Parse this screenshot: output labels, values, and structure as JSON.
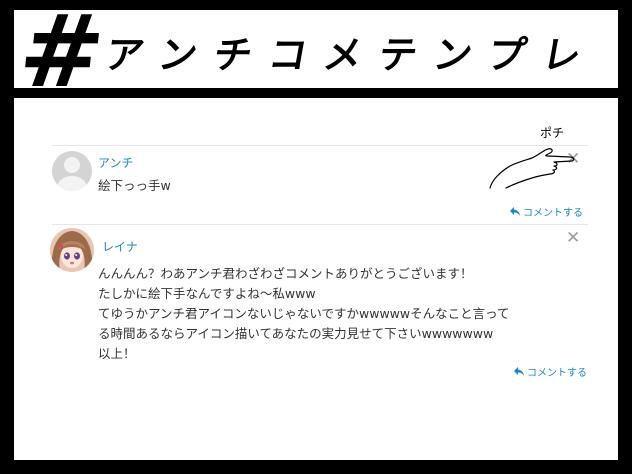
{
  "title": {
    "hash": "#",
    "text": "アンチコメテンプレ"
  },
  "annotation": {
    "poke_label": "ポチ"
  },
  "comments": [
    {
      "author": "アンチ",
      "lines": [
        "絵下っっ手w"
      ],
      "reply_label": "コメントする",
      "close_symbol": "✕"
    },
    {
      "author": "レイナ",
      "lines": [
        "んんんん？わあアンチ君わざわざコメントありがとうございます！",
        "たしかに絵下手なんですよね〜私www",
        "てゆうかアンチ君アイコンないじゃないですかwwwwwそんなこと言って",
        "る時間あるならアイコン描いてあなたの実力見せて下さいwwwwwww",
        "以上！"
      ],
      "reply_label": "コメントする",
      "close_symbol": "✕"
    }
  ],
  "colors": {
    "link": "#1e88c7",
    "text": "#333333",
    "frame": "#000000"
  },
  "icons": [
    "default-avatar-icon",
    "close-icon",
    "reply-icon",
    "pointing-hand-icon"
  ]
}
